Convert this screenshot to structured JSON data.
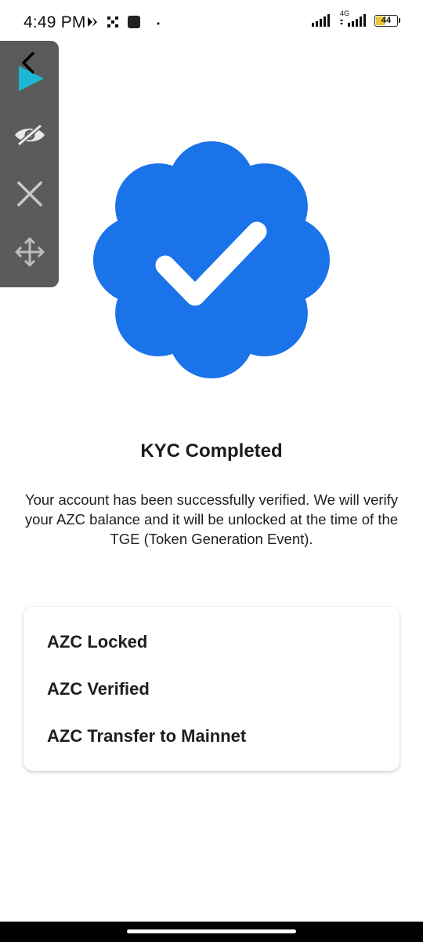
{
  "status_bar": {
    "time": "4:49 PM",
    "network": "4G",
    "battery": "44"
  },
  "tool_panel": {
    "icons": [
      "back-chevron-icon",
      "play-icon",
      "hide-eye-icon",
      "close-icon",
      "move-icon"
    ]
  },
  "badge": {
    "color": "#1a73e8",
    "icon": "verified-checkmark-icon"
  },
  "kyc": {
    "title": "KYC Completed",
    "description": "Your account has been successfully verified. We will verify your AZC balance and it will be unlocked at the time of the TGE (Token Generation Event)."
  },
  "status_card": {
    "items": [
      {
        "label": "AZC Locked"
      },
      {
        "label": "AZC Verified"
      },
      {
        "label": "AZC Transfer to Mainnet"
      }
    ]
  }
}
